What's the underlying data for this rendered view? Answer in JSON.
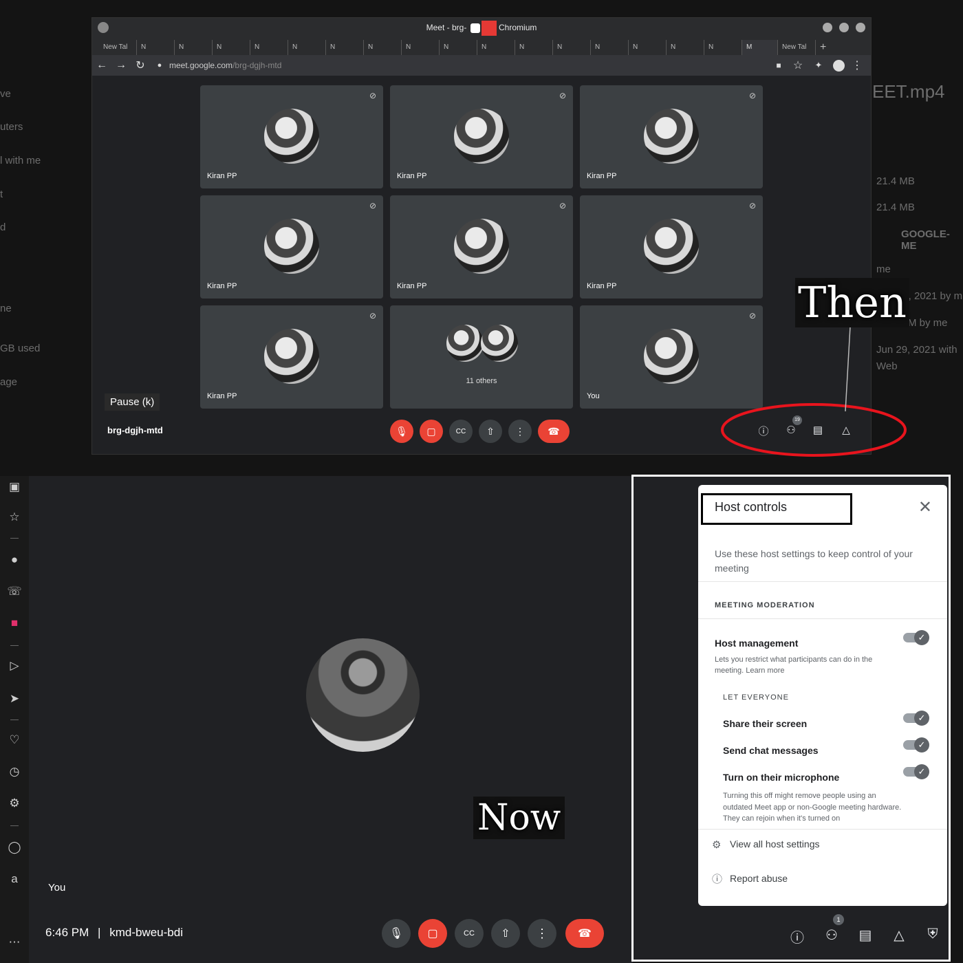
{
  "background": {
    "left_fragments": [
      "ve",
      "uters",
      "l with me",
      "t",
      "d",
      "ne",
      "GB used",
      "age"
    ],
    "right_fragments": [
      "EET.mp4",
      "21.4 MB",
      "21.4 MB",
      "GOOGLE-ME",
      "me",
      "29, 2021 by m",
      "PM by me",
      "Jun 29, 2021 with",
      "Web"
    ]
  },
  "browser": {
    "title": "Meet - brg-",
    "app_name": "Chromium",
    "tabs": [
      "New Tal",
      "N",
      "N",
      "N",
      "N",
      "N",
      "N",
      "N",
      "N",
      "N",
      "N",
      "N",
      "N",
      "N",
      "N",
      "N",
      "N"
    ],
    "active_tab": "M",
    "new_tab": "New Tal",
    "url_host": "meet.google.com",
    "url_path": "/brg-dgjh-mtd"
  },
  "then_meet": {
    "tiles": [
      {
        "name": "Kiran PP"
      },
      {
        "name": "Kiran PP"
      },
      {
        "name": "Kiran PP"
      },
      {
        "name": "Kiran PP"
      },
      {
        "name": "Kiran PP"
      },
      {
        "name": "Kiran PP"
      },
      {
        "name": "Kiran PP"
      },
      {
        "name": "11 others"
      },
      {
        "name": "You"
      }
    ],
    "pause_label": "Pause (k)",
    "meeting_code": "brg-dgjh-mtd",
    "participants_badge": "19"
  },
  "now_meet": {
    "self_label": "You",
    "time": "6:46 PM",
    "separator": "|",
    "meeting_code": "kmd-bweu-bdi",
    "participants_badge": "1"
  },
  "host_controls": {
    "title": "Host controls",
    "description": "Use these host settings to keep control of your meeting",
    "section": "MEETING MODERATION",
    "host_management": {
      "label": "Host management",
      "description": "Lets you restrict what participants can do in the meeting. Learn more",
      "enabled": true
    },
    "let_everyone": "LET EVERYONE",
    "options": [
      {
        "label": "Share their screen",
        "enabled": true
      },
      {
        "label": "Send chat messages",
        "enabled": true
      },
      {
        "label": "Turn on their microphone",
        "enabled": true
      }
    ],
    "mic_note": "Turning this off might remove people using an outdated Meet app or non-Google meeting hardware. They can rejoin when it's turned on",
    "view_all": "View all host settings",
    "report_abuse": "Report abuse"
  },
  "annotations": {
    "then": "Then",
    "now": "Now"
  },
  "colors": {
    "red": "#ea4335",
    "annotation_ellipse": "#e8141d",
    "meet_bg": "#202124"
  }
}
